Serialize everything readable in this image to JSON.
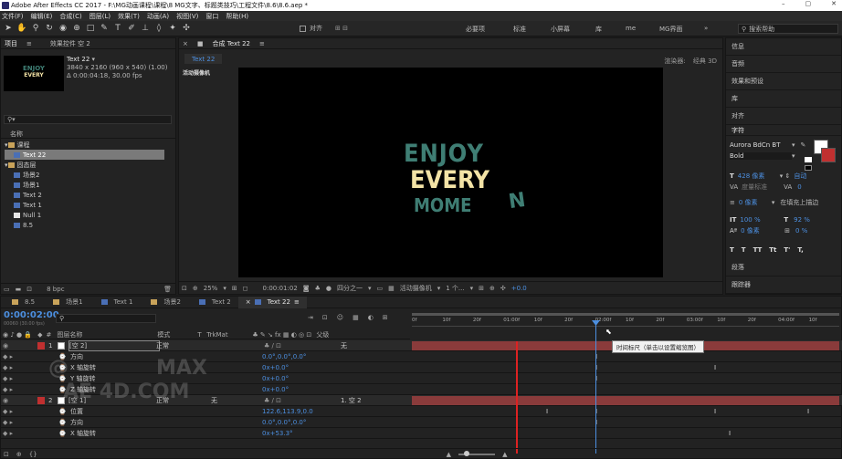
{
  "title": "Adobe After Effects CC 2017 - F:\\MG动画课程\\课程\\8 MG文字、标题类技巧\\工程文件\\8.6\\8.6.aep *",
  "menu": [
    "文件(F)",
    "编辑(E)",
    "合成(C)",
    "图层(L)",
    "效果(T)",
    "动画(A)",
    "视图(V)",
    "窗口",
    "帮助(H)"
  ],
  "toolbar": {
    "align_label": "对齐",
    "workspaces": [
      "必要项",
      "标准",
      "小屏幕",
      "库",
      "me",
      "MG界面"
    ],
    "search_placeholder": "搜索帮助"
  },
  "project": {
    "tab_project": "项目",
    "tab_effects": "效果控件 空 2",
    "comp_name": "Text 22",
    "comp_size": "3840 x 2160 (960 x 540) (1.00)",
    "comp_duration": "Δ 0:00:04:18, 30.00 fps",
    "thumb_lines": [
      "ENJOY",
      "EVERY",
      "MOME"
    ],
    "col_name": "名称",
    "items": [
      {
        "label": "课程",
        "type": "folder"
      },
      {
        "label": "Text 22",
        "type": "comp",
        "selected": true
      },
      {
        "label": "固态层",
        "type": "folder"
      },
      {
        "label": "场景2",
        "type": "comp"
      },
      {
        "label": "场景1",
        "type": "comp"
      },
      {
        "label": "Text 2",
        "type": "comp"
      },
      {
        "label": "Text 1",
        "type": "comp"
      },
      {
        "label": "Null 1",
        "type": "null"
      },
      {
        "label": "8.5",
        "type": "comp"
      }
    ],
    "bpc": "8 bpc"
  },
  "comp": {
    "tab_label": "合成 Text 22",
    "sub_tab": "Text 22",
    "renderer_label": "渲染器:",
    "renderer": "经典 3D",
    "camera_label": "活动摄像机",
    "canvas_lines": [
      "ENJOY",
      "EVERY",
      "MOME"
    ],
    "canvas_trailing": "N",
    "canvas_colors": {
      "enjoy": "#3f7e74",
      "every": "#f3e3a6",
      "mome": "#3f7e74"
    },
    "zoom": "25%",
    "timecode": "0:00:01:02",
    "resolution": "四分之一",
    "view": "活动摄像机",
    "views": "1 个...",
    "exposure": "+0.0"
  },
  "right_panel": {
    "sections": [
      "信息",
      "音频",
      "效果和预设",
      "库",
      "对齐"
    ],
    "char_title": "字符",
    "font": "Aurora BdCn BT",
    "style": "Bold",
    "size": "428 像素",
    "leading": "自动",
    "tracking_label": "度量标准",
    "tracking": "0",
    "stroke_width": "0 像素",
    "stroke_mode": "在填充上描边",
    "vscale": "100 %",
    "hscale": "92 %",
    "baseline": "0 像素",
    "tsume": "0 %",
    "type_buttons": [
      "T",
      "T",
      "TT",
      "Tt",
      "T'",
      "T,"
    ],
    "para": "段落",
    "tracker": "跟踪器"
  },
  "timeline": {
    "tabs": [
      "8.5",
      "场景1",
      "Text 1",
      "场景2",
      "Text 2",
      "Text 22"
    ],
    "current_time": "0:00:02:00",
    "current_time_sub": "00060 (30.00 fps)",
    "cols": {
      "name": "图层名称",
      "mode": "模式",
      "trkmat": "TrkMat",
      "parent": "父级"
    },
    "ruler": [
      "0f",
      "10f",
      "20f",
      "01:00f",
      "10f",
      "20f",
      "02:00f",
      "10f",
      "20f",
      "03:00f",
      "10f",
      "20f",
      "04:00f",
      "10f"
    ],
    "tooltip": "时间标尺（单击以设置缩览图）",
    "rows": [
      {
        "num": "1",
        "name": "[空 2]",
        "mode": "正常",
        "trkmat": "",
        "parent": "无",
        "value": "",
        "kind": "layer"
      },
      {
        "num": "",
        "name": "方向",
        "value": "0.0°,0.0°,0.0°",
        "kind": "prop"
      },
      {
        "num": "",
        "name": "X 轴旋转",
        "value": "0x+0.0°",
        "kind": "prop"
      },
      {
        "num": "",
        "name": "Y 轴旋转",
        "value": "0x+0.0°",
        "kind": "prop"
      },
      {
        "num": "",
        "name": "Z 轴旋转",
        "value": "0x+0.0°",
        "kind": "prop"
      },
      {
        "num": "2",
        "name": "[空 1]",
        "mode": "正常",
        "trkmat": "无",
        "parent": "1. 空 2",
        "value": "",
        "kind": "layer"
      },
      {
        "num": "",
        "name": "位置",
        "value": "122.6,113.9,0.0",
        "kind": "prop"
      },
      {
        "num": "",
        "name": "方向",
        "value": "0.0°,0.0°,0.0°",
        "kind": "prop"
      },
      {
        "num": "",
        "name": "X 轴旋转",
        "value": "0x+53.3°",
        "kind": "prop"
      }
    ],
    "watermark": [
      "@",
      "MAX",
      "AE 4D.COM"
    ]
  }
}
